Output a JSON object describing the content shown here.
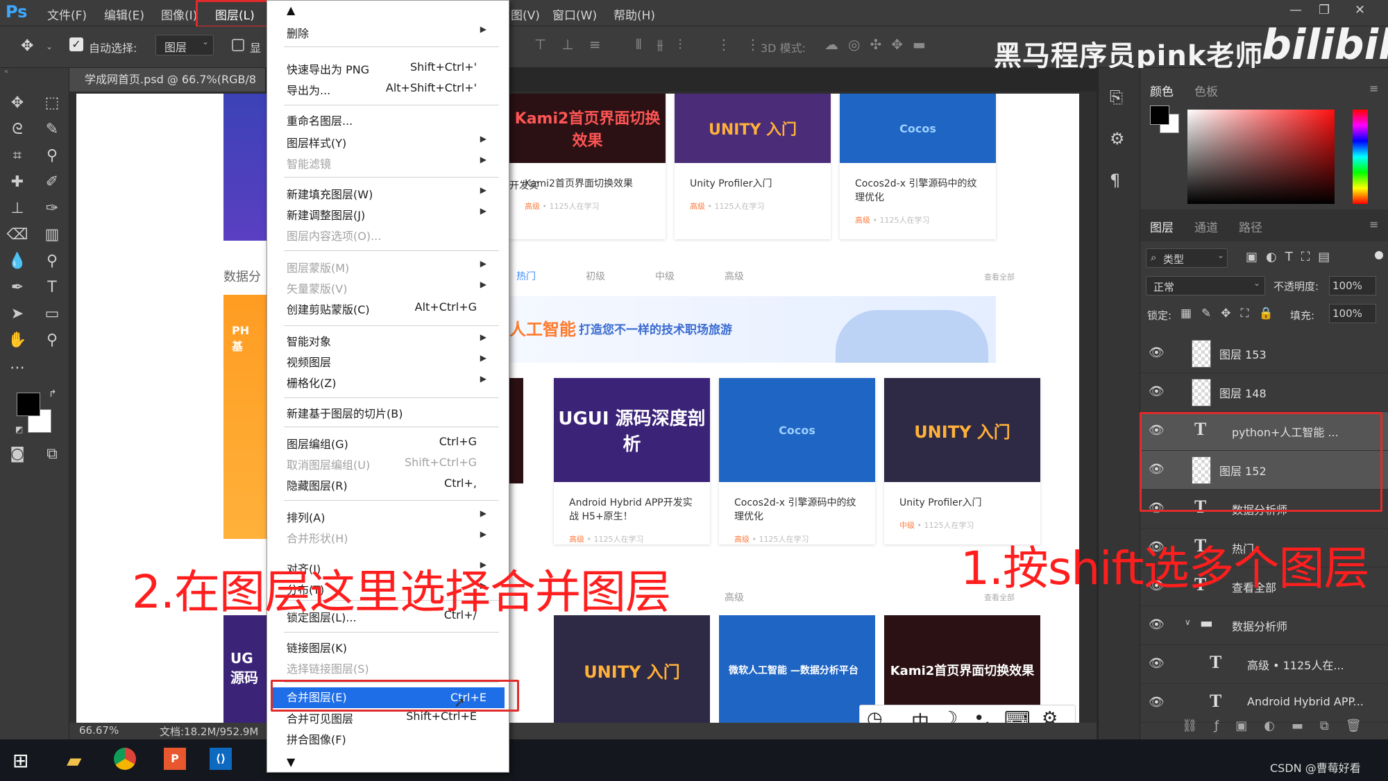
{
  "app": {
    "logo": "Ps"
  },
  "menubar": {
    "items": [
      "文件(F)",
      "编辑(E)",
      "图像(I)",
      "图层(L)",
      "图(V)",
      "窗口(W)",
      "帮助(H)"
    ],
    "window_controls": [
      "—",
      "❐",
      "✕"
    ]
  },
  "options": {
    "auto_select_label": "自动选择:",
    "auto_select_value": "图层",
    "show_label": "显",
    "mode3d_label": "3D 模式:"
  },
  "watermark": {
    "text": "黑马程序员pink老师",
    "brand": "bilibili"
  },
  "document": {
    "tab_title": "学成网首页.psd @ 66.7%(RGB/8",
    "zoom": "66.67%",
    "doc_size": "文档:18.2M/952.9M"
  },
  "layer_menu": {
    "items": [
      {
        "label": "删除",
        "shortcut": "",
        "submenu": true,
        "disabled": false
      },
      {
        "label": "快速导出为 PNG",
        "shortcut": "Shift+Ctrl+'",
        "submenu": false,
        "disabled": false
      },
      {
        "label": "导出为...",
        "shortcut": "Alt+Shift+Ctrl+'",
        "submenu": false,
        "disabled": false
      },
      {
        "label": "重命名图层...",
        "shortcut": "",
        "submenu": false,
        "disabled": false
      },
      {
        "label": "图层样式(Y)",
        "shortcut": "",
        "submenu": true,
        "disabled": false
      },
      {
        "label": "智能滤镜",
        "shortcut": "",
        "submenu": true,
        "disabled": true
      },
      {
        "label": "新建填充图层(W)",
        "shortcut": "",
        "submenu": true,
        "disabled": false
      },
      {
        "label": "新建调整图层(J)",
        "shortcut": "",
        "submenu": true,
        "disabled": false
      },
      {
        "label": "图层内容选项(O)...",
        "shortcut": "",
        "submenu": false,
        "disabled": true
      },
      {
        "label": "图层蒙版(M)",
        "shortcut": "",
        "submenu": true,
        "disabled": true
      },
      {
        "label": "矢量蒙版(V)",
        "shortcut": "",
        "submenu": true,
        "disabled": true
      },
      {
        "label": "创建剪贴蒙版(C)",
        "shortcut": "Alt+Ctrl+G",
        "submenu": false,
        "disabled": false
      },
      {
        "label": "智能对象",
        "shortcut": "",
        "submenu": true,
        "disabled": false
      },
      {
        "label": "视频图层",
        "shortcut": "",
        "submenu": true,
        "disabled": false
      },
      {
        "label": "栅格化(Z)",
        "shortcut": "",
        "submenu": true,
        "disabled": false
      },
      {
        "label": "新建基于图层的切片(B)",
        "shortcut": "",
        "submenu": false,
        "disabled": false
      },
      {
        "label": "图层编组(G)",
        "shortcut": "Ctrl+G",
        "submenu": false,
        "disabled": false
      },
      {
        "label": "取消图层编组(U)",
        "shortcut": "Shift+Ctrl+G",
        "submenu": false,
        "disabled": true
      },
      {
        "label": "隐藏图层(R)",
        "shortcut": "Ctrl+,",
        "submenu": false,
        "disabled": false
      },
      {
        "label": "排列(A)",
        "shortcut": "",
        "submenu": true,
        "disabled": false
      },
      {
        "label": "合并形状(H)",
        "shortcut": "",
        "submenu": true,
        "disabled": true
      },
      {
        "label": "对齐(I)",
        "shortcut": "",
        "submenu": true,
        "disabled": false
      },
      {
        "label": "分布(T)",
        "shortcut": "",
        "submenu": true,
        "disabled": false
      },
      {
        "label": "锁定图层(L)...",
        "shortcut": "Ctrl+/",
        "submenu": false,
        "disabled": false
      },
      {
        "label": "链接图层(K)",
        "shortcut": "",
        "submenu": false,
        "disabled": false
      },
      {
        "label": "选择链接图层(S)",
        "shortcut": "",
        "submenu": false,
        "disabled": true
      },
      {
        "label": "合并图层(E)",
        "shortcut": "Ctrl+E",
        "submenu": false,
        "disabled": false,
        "highlighted": true
      },
      {
        "label": "合并可见图层",
        "shortcut": "Shift+Ctrl+E",
        "submenu": false,
        "disabled": false
      },
      {
        "label": "拼合图像(F)",
        "shortcut": "",
        "submenu": false,
        "disabled": false
      }
    ]
  },
  "canvas_page": {
    "left_section_label": "数据分",
    "left_banner_text": "PH 基",
    "left_bottom_text": "UG 源码",
    "row1": [
      {
        "thumb": "",
        "title": "开发实",
        "meta_tag": "",
        "meta": ""
      },
      {
        "thumb": "Kami2首页界面切换效果",
        "title": "Kami2首页界面切换效果",
        "meta_tag": "高级",
        "meta": "• 1125人在学习"
      },
      {
        "thumb": "UNITY 入门",
        "title": "Unity Profiler入门",
        "meta_tag": "高级",
        "meta": "• 1125人在学习"
      },
      {
        "thumb": "Cocos",
        "title": "Cocos2d-x 引擎源码中的纹理优化",
        "meta_tag": "高级",
        "meta": "• 1125人在学习"
      }
    ],
    "tabs": [
      "热门",
      "初级",
      "中级",
      "高级"
    ],
    "view_all": "查看全部",
    "banner_title": "人工智能",
    "banner_sub": "打造您不一样的技术职场旅游",
    "row2": [
      {
        "thumb": "UGUI 源码深度剖析",
        "title": "Android Hybrid APP开发实战 H5+原生！",
        "meta_tag": "高级",
        "meta": "• 1125人在学习"
      },
      {
        "thumb": "Cocos",
        "title": "Cocos2d-x 引擎源码中的纹理优化",
        "meta_tag": "高级",
        "meta": "• 1125人在学习"
      },
      {
        "thumb": "UNITY 入门",
        "title": "Unity Profiler入门",
        "meta_tag": "中级",
        "meta": "• 1125人在学习"
      }
    ],
    "row3_tab": "高级",
    "row3": [
      {
        "thumb": "UNITY 入门"
      },
      {
        "thumb": "微软人工智能 —数据分析平台"
      },
      {
        "thumb": "Kami2首页界面切换效果"
      }
    ]
  },
  "color_panel": {
    "tabs": [
      "颜色",
      "色板"
    ]
  },
  "layers_panel": {
    "tabs": [
      "图层",
      "通道",
      "路径"
    ],
    "filter_label": "类型",
    "blend_mode": "正常",
    "opacity_label": "不透明度:",
    "opacity_value": "100%",
    "lock_label": "锁定:",
    "fill_label": "填充:",
    "fill_value": "100%",
    "layers": [
      {
        "name": "图层 153",
        "kind": "pixel",
        "selected": false,
        "indent": 0
      },
      {
        "name": "图层 148",
        "kind": "pixel",
        "selected": false,
        "indent": 0
      },
      {
        "name": "python+人工智能 ...",
        "kind": "text",
        "selected": true,
        "indent": 0
      },
      {
        "name": "图层 152",
        "kind": "pixel",
        "selected": true,
        "indent": 0
      },
      {
        "name": "数据分析师",
        "kind": "text",
        "selected": false,
        "indent": 0
      },
      {
        "name": "热门",
        "kind": "text",
        "selected": false,
        "indent": 0
      },
      {
        "name": "查看全部",
        "kind": "text",
        "selected": false,
        "indent": 0
      },
      {
        "name": "数据分析师",
        "kind": "group",
        "selected": false,
        "indent": 0
      },
      {
        "name": "高级 • 1125人在...",
        "kind": "text",
        "selected": false,
        "indent": 1
      },
      {
        "name": "Android Hybrid APP...",
        "kind": "text",
        "selected": false,
        "indent": 1
      }
    ]
  },
  "annotations": {
    "step1": "1.按shift选多个图层",
    "step2": "2.在图层这里选择合并图层"
  },
  "ime": {
    "items": [
      "中",
      "☽",
      "•,",
      "⌨",
      "⚙"
    ]
  },
  "taskbar": {
    "credit": "CSDN @曹莓好看"
  }
}
